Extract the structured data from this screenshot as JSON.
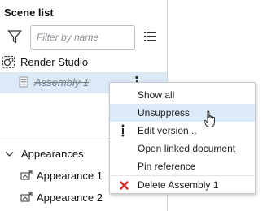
{
  "panel": {
    "title": "Scene list",
    "filter_placeholder": "Filter by name"
  },
  "tree": {
    "root_label": "Render Studio",
    "assembly_label": "Assembly 1",
    "appearances_label": "Appearances",
    "appearance_items": [
      "Appearance 1",
      "Appearance 2"
    ]
  },
  "context_menu": {
    "items": [
      {
        "label": "Show all",
        "icon": ""
      },
      {
        "label": "Unsuppress",
        "icon": ""
      },
      {
        "label": "Edit version...",
        "icon": "vertical-dots-icon"
      },
      {
        "label": "Open linked document",
        "icon": ""
      },
      {
        "label": "Pin reference",
        "icon": ""
      },
      {
        "label": "Delete Assembly 1",
        "icon": "red-x-icon"
      }
    ]
  },
  "colors": {
    "selection": "#dceaf8",
    "delete_icon": "#d9262b"
  }
}
